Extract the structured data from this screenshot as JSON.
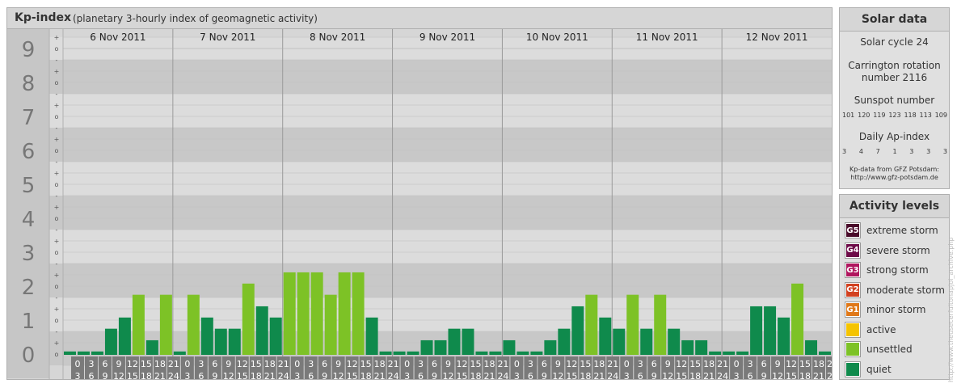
{
  "header": {
    "title": "Kp-index",
    "subtitle": "(planetary 3-hourly index of geomagnetic activity)"
  },
  "chart_data": {
    "type": "bar",
    "y_levels": [
      "0",
      "1",
      "2",
      "3",
      "4",
      "5",
      "6",
      "7",
      "8",
      "9"
    ],
    "sub_ticks": [
      "o",
      "+",
      "-"
    ],
    "ylim": [
      0,
      9.33
    ],
    "days": [
      "6 Nov 2011",
      "7 Nov 2011",
      "8 Nov 2011",
      "9 Nov 2011",
      "10 Nov 2011",
      "11 Nov 2011",
      "12 Nov 2011"
    ],
    "hour_start": [
      "0",
      "3",
      "6",
      "9",
      "12",
      "15",
      "18",
      "21"
    ],
    "hour_end": [
      "3",
      "6",
      "9",
      "12",
      "15",
      "18",
      "21",
      "24"
    ],
    "values": [
      [
        0,
        0,
        0,
        0.67,
        1.0,
        1.67,
        0.33,
        1.67
      ],
      [
        0,
        1.67,
        1.0,
        0.67,
        0.67,
        2.0,
        1.33,
        1.0
      ],
      [
        2.33,
        2.33,
        2.33,
        1.67,
        2.33,
        2.33,
        1.0,
        0
      ],
      [
        0,
        0,
        0.33,
        0.33,
        0.67,
        0.67,
        0,
        0
      ],
      [
        0.33,
        0,
        0,
        0.33,
        0.67,
        1.33,
        1.67,
        1.0
      ],
      [
        0.67,
        1.67,
        0.67,
        1.67,
        0.67,
        0.33,
        0.33,
        0
      ],
      [
        0,
        0,
        1.33,
        1.33,
        1.0,
        2.0,
        0.33,
        0
      ]
    ],
    "threshold_colors": {
      "quiet": "#0f8a4c",
      "unsettled": "#7dc226"
    }
  },
  "solar": {
    "title": "Solar data",
    "cycle": "Solar cycle 24",
    "carrington_line1": "Carrington rotation",
    "carrington_line2": "number 2116",
    "sunspot_label": "Sunspot number",
    "sunspots": [
      "101",
      "120",
      "119",
      "123",
      "118",
      "113",
      "109"
    ],
    "ap_label": "Daily Ap-index",
    "ap": [
      "3",
      "4",
      "7",
      "1",
      "3",
      "3",
      "3"
    ],
    "credit_line1": "Kp-data from GFZ Potsdam:",
    "credit_line2": "http://www.gfz-potsdam.de"
  },
  "levels": {
    "title": "Activity levels",
    "items": [
      {
        "code": "G5",
        "label": "extreme storm",
        "color": "#4a0a2a"
      },
      {
        "code": "G4",
        "label": "severe storm",
        "color": "#6e0a48"
      },
      {
        "code": "G3",
        "label": "strong storm",
        "color": "#b0155e"
      },
      {
        "code": "G2",
        "label": "moderate storm",
        "color": "#d2401f"
      },
      {
        "code": "G1",
        "label": "minor storm",
        "color": "#e07818"
      },
      {
        "code": "",
        "label": "active",
        "color": "#f5c400"
      },
      {
        "code": "",
        "label": "unsettled",
        "color": "#7dc226"
      },
      {
        "code": "",
        "label": "quiet",
        "color": "#0f8a4c"
      }
    ]
  },
  "vertical_credit": "http://www.theusecerfultonapjoi_archive.php"
}
